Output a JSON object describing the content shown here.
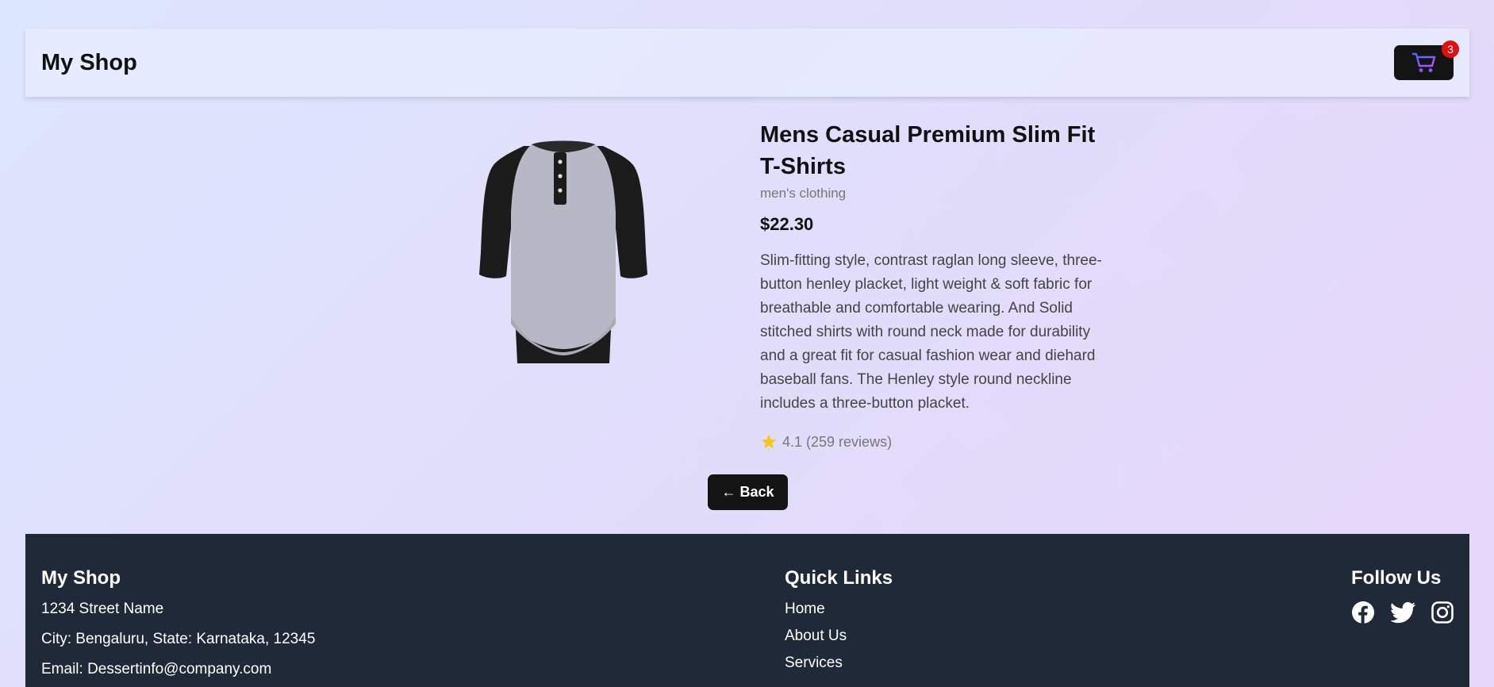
{
  "header": {
    "brand": "My Shop",
    "cart_count": "3"
  },
  "product": {
    "title": "Mens Casual Premium Slim Fit T-Shirts",
    "category": "men's clothing",
    "price": "$22.30",
    "description": "Slim-fitting style, contrast raglan long sleeve, three-button henley placket, light weight & soft fabric for breathable and comfortable wearing. And Solid stitched shirts with round neck made for durability and a great fit for casual fashion wear and diehard baseball fans. The Henley style round neckline includes a three-button placket.",
    "rating": "4.1 (259 reviews)"
  },
  "back_label": "← Back",
  "footer": {
    "brand": "My Shop",
    "address1": "1234 Street Name",
    "address2": "City: Bengaluru, State: Karnataka, 12345",
    "email": "Email: Dessertinfo@company.com",
    "quick_links_title": "Quick Links",
    "links": [
      "Home",
      "About Us",
      "Services"
    ],
    "follow_title": "Follow Us",
    "social_icons": [
      "facebook-icon",
      "twitter-icon",
      "instagram-icon"
    ]
  },
  "colors": {
    "accent_dark": "#141414",
    "footer_bg": "#1f2937",
    "badge": "#e01010",
    "star": "#f5c518"
  }
}
